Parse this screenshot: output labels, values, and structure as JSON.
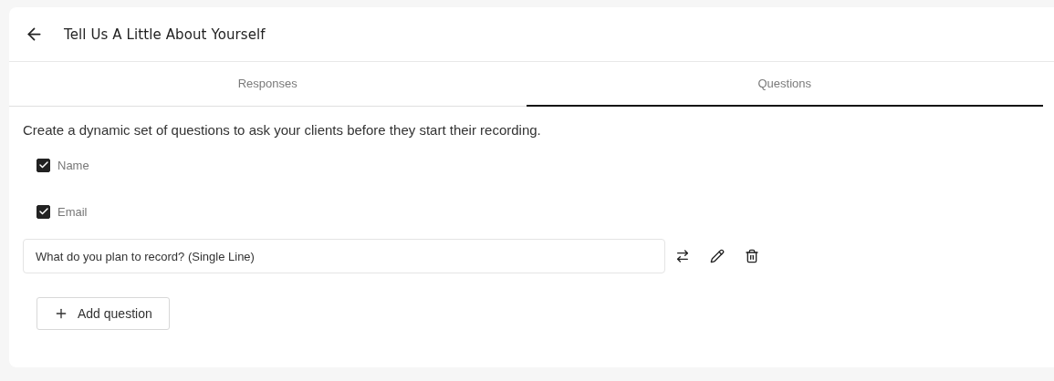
{
  "header": {
    "title": "Tell Us A Little About Yourself"
  },
  "tabs": [
    {
      "label": "Responses",
      "selected": false
    },
    {
      "label": "Questions",
      "selected": true
    }
  ],
  "description": "Create a dynamic set of questions to ask your clients before they start their recording.",
  "fields": [
    {
      "label": "Name",
      "checked": true
    },
    {
      "label": "Email",
      "checked": true
    }
  ],
  "questions": [
    {
      "text": "What do you plan to record? (Single Line)"
    }
  ],
  "add_button": {
    "label": "Add question"
  }
}
